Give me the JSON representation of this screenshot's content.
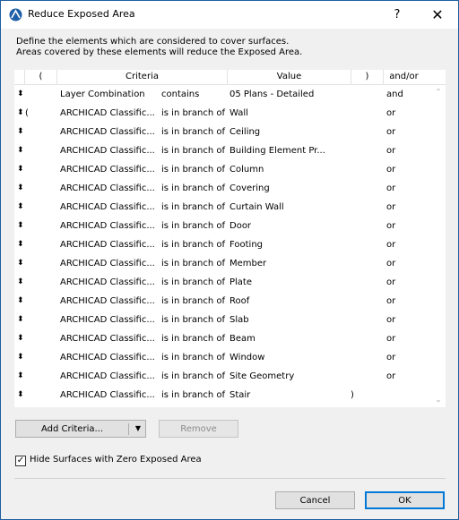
{
  "window": {
    "title": "Reduce Exposed Area",
    "help_label": "?",
    "close_label": "✕"
  },
  "description": {
    "line1": "Define the elements which are considered to cover surfaces.",
    "line2": "Areas covered by these elements will reduce the Exposed Area."
  },
  "table": {
    "headers": {
      "lparen": "(",
      "criteria": "Criteria",
      "value": "Value",
      "rparen": ")",
      "andor": "and/or"
    },
    "rows": [
      {
        "handle": "⬍",
        "lparen": "",
        "criteria": "Layer Combination",
        "operator": "contains",
        "value": "05 Plans - Detailed",
        "rparen": "",
        "andor": "and"
      },
      {
        "handle": "⬍",
        "lparen": "(",
        "criteria": "ARCHICAD Classific...",
        "operator": "is in branch of",
        "value": "Wall",
        "rparen": "",
        "andor": "or"
      },
      {
        "handle": "⬍",
        "lparen": "",
        "criteria": "ARCHICAD Classific...",
        "operator": "is in branch of",
        "value": "Ceiling",
        "rparen": "",
        "andor": "or"
      },
      {
        "handle": "⬍",
        "lparen": "",
        "criteria": "ARCHICAD Classific...",
        "operator": "is in branch of",
        "value": "Building Element Pr...",
        "rparen": "",
        "andor": "or"
      },
      {
        "handle": "⬍",
        "lparen": "",
        "criteria": "ARCHICAD Classific...",
        "operator": "is in branch of",
        "value": "Column",
        "rparen": "",
        "andor": "or"
      },
      {
        "handle": "⬍",
        "lparen": "",
        "criteria": "ARCHICAD Classific...",
        "operator": "is in branch of",
        "value": "Covering",
        "rparen": "",
        "andor": "or"
      },
      {
        "handle": "⬍",
        "lparen": "",
        "criteria": "ARCHICAD Classific...",
        "operator": "is in branch of",
        "value": "Curtain Wall",
        "rparen": "",
        "andor": "or"
      },
      {
        "handle": "⬍",
        "lparen": "",
        "criteria": "ARCHICAD Classific...",
        "operator": "is in branch of",
        "value": "Door",
        "rparen": "",
        "andor": "or"
      },
      {
        "handle": "⬍",
        "lparen": "",
        "criteria": "ARCHICAD Classific...",
        "operator": "is in branch of",
        "value": "Footing",
        "rparen": "",
        "andor": "or"
      },
      {
        "handle": "⬍",
        "lparen": "",
        "criteria": "ARCHICAD Classific...",
        "operator": "is in branch of",
        "value": "Member",
        "rparen": "",
        "andor": "or"
      },
      {
        "handle": "⬍",
        "lparen": "",
        "criteria": "ARCHICAD Classific...",
        "operator": "is in branch of",
        "value": "Plate",
        "rparen": "",
        "andor": "or"
      },
      {
        "handle": "⬍",
        "lparen": "",
        "criteria": "ARCHICAD Classific...",
        "operator": "is in branch of",
        "value": "Roof",
        "rparen": "",
        "andor": "or"
      },
      {
        "handle": "⬍",
        "lparen": "",
        "criteria": "ARCHICAD Classific...",
        "operator": "is in branch of",
        "value": "Slab",
        "rparen": "",
        "andor": "or"
      },
      {
        "handle": "⬍",
        "lparen": "",
        "criteria": "ARCHICAD Classific...",
        "operator": "is in branch of",
        "value": "Beam",
        "rparen": "",
        "andor": "or"
      },
      {
        "handle": "⬍",
        "lparen": "",
        "criteria": "ARCHICAD Classific...",
        "operator": "is in branch of",
        "value": "Window",
        "rparen": "",
        "andor": "or"
      },
      {
        "handle": "⬍",
        "lparen": "",
        "criteria": "ARCHICAD Classific...",
        "operator": "is in branch of",
        "value": "Site Geometry",
        "rparen": "",
        "andor": "or"
      },
      {
        "handle": "⬍",
        "lparen": "",
        "criteria": "ARCHICAD Classific...",
        "operator": "is in branch of",
        "value": "Stair",
        "rparen": ")",
        "andor": ""
      }
    ]
  },
  "buttons": {
    "add_criteria": "Add Criteria...",
    "add_dropdown_arrow": "▼",
    "remove": "Remove",
    "cancel": "Cancel",
    "ok": "OK"
  },
  "options": {
    "hide_zero_label": "Hide Surfaces with Zero Exposed Area",
    "hide_zero_checked": true,
    "check_mark": "✓"
  },
  "colors": {
    "accent": "#0078d7",
    "title_border": "#1f5f9f"
  }
}
